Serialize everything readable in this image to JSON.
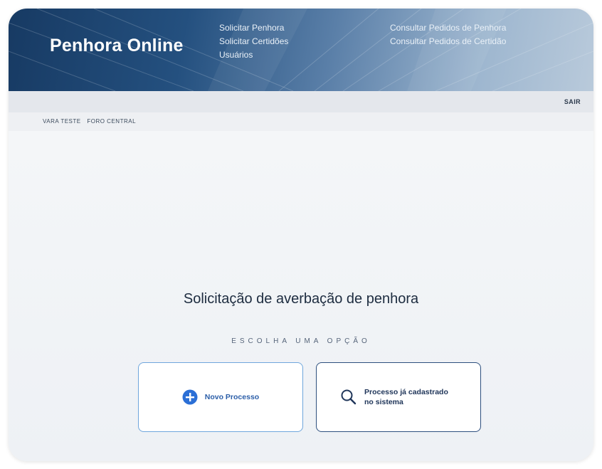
{
  "header": {
    "brand": "Penhora Online",
    "nav_left": [
      "Solicitar Penhora",
      "Solicitar Certidões",
      "Usuários"
    ],
    "nav_right": [
      "Consultar Pedidos de Penhora",
      "Consultar Pedidos de Certidão"
    ]
  },
  "topbar": {
    "logout": "SAIR"
  },
  "breadcrumb": {
    "court": "VARA TESTE",
    "forum": "FORO CENTRAL"
  },
  "main": {
    "title": "Solicitação de averbação de penhora",
    "subtitle": "ESCOLHA UMA OPÇÃO",
    "options": [
      {
        "label": "Novo Processo",
        "icon": "plus-circle-icon"
      },
      {
        "label": "Processo já cadastrado no sistema",
        "icon": "search-icon"
      }
    ]
  },
  "colors": {
    "header_dark": "#173a63",
    "accent": "#2b6fd6",
    "card_border_new": "#6fa6dc",
    "card_border_existing": "#2d4f7e"
  }
}
